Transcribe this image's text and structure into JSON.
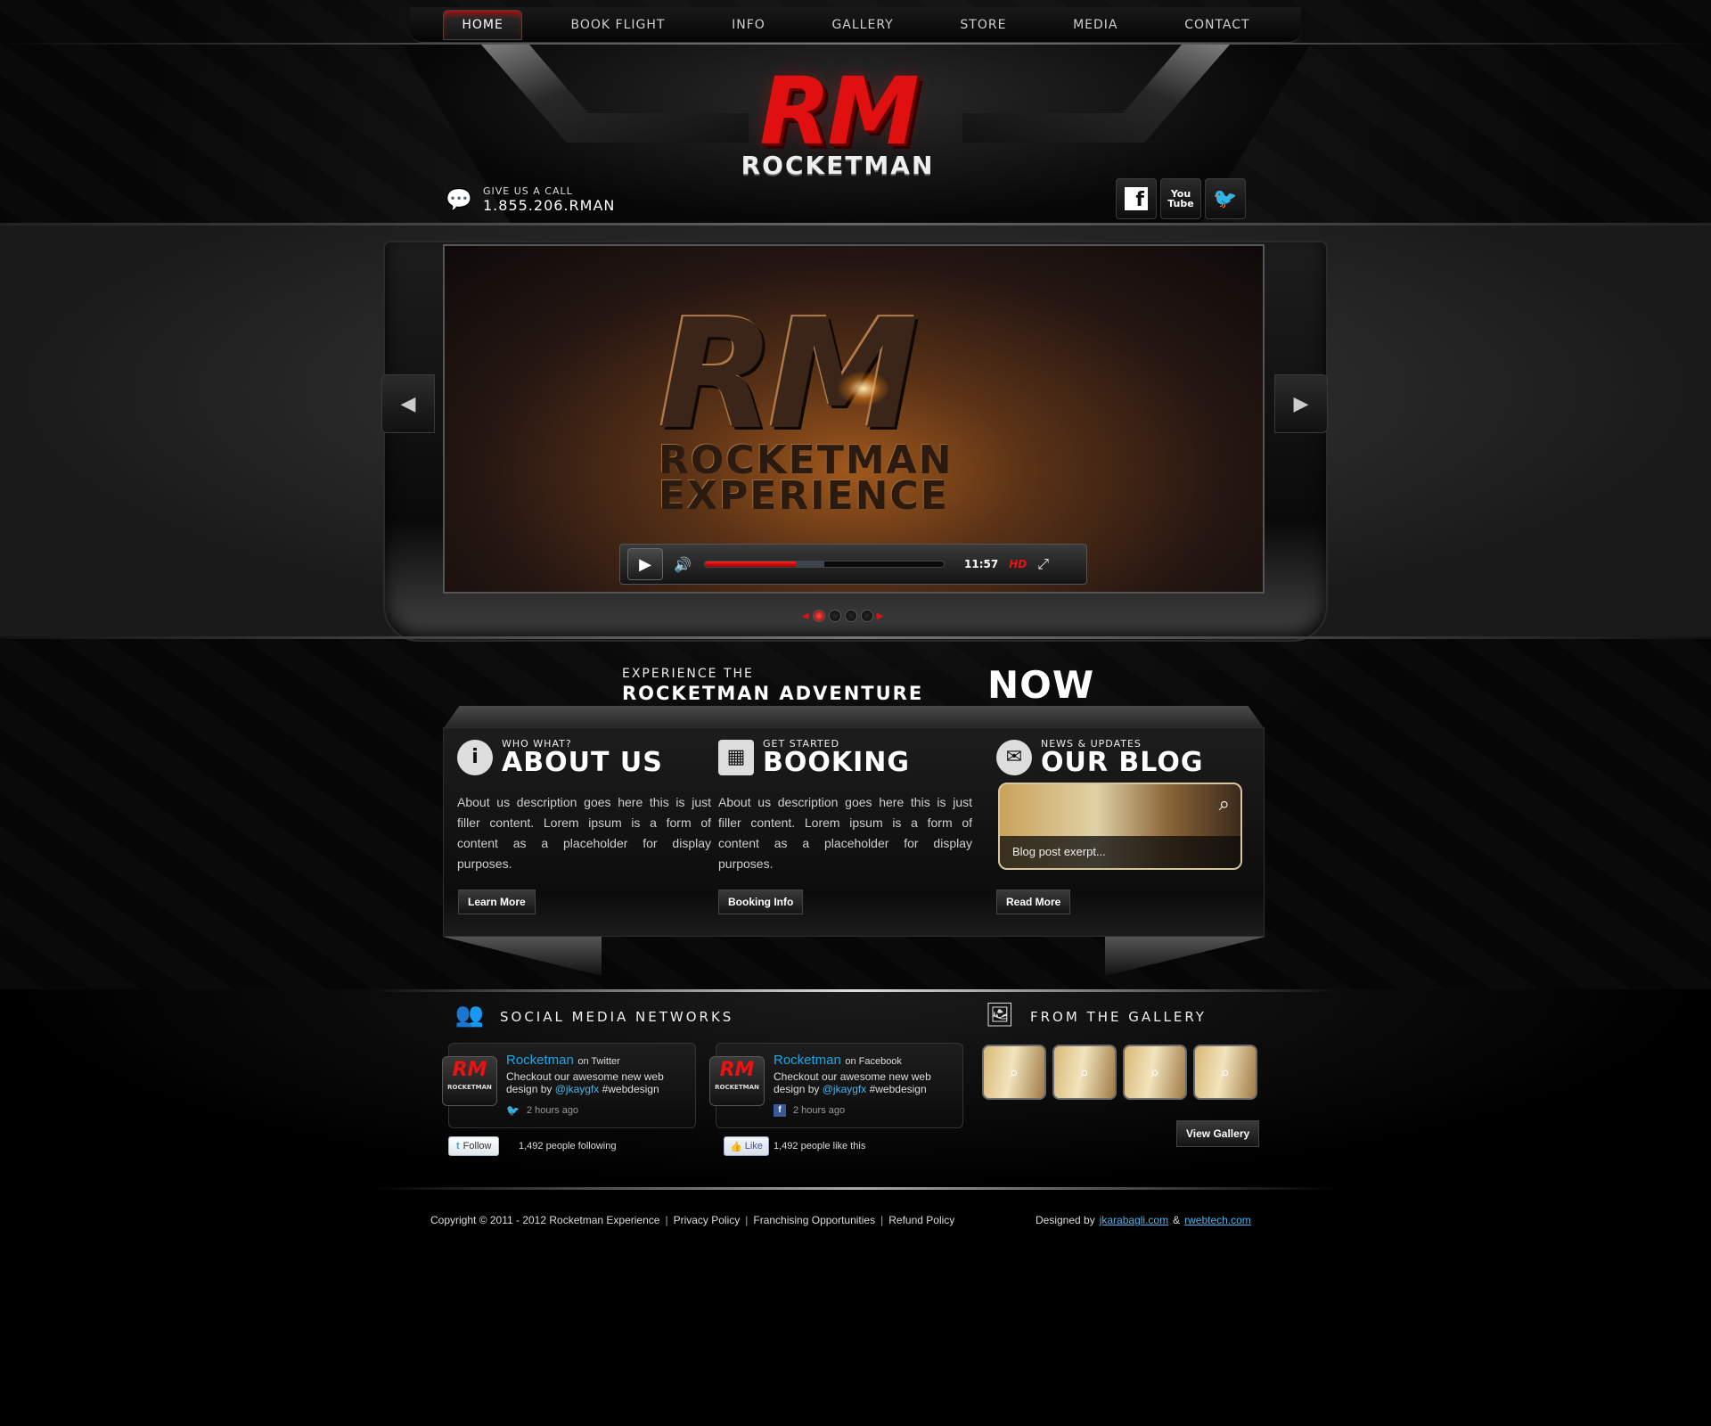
{
  "nav": {
    "items": [
      "HOME",
      "BOOK FLIGHT",
      "INFO",
      "GALLERY",
      "STORE",
      "MEDIA",
      "CONTACT"
    ],
    "active_index": 0
  },
  "header": {
    "logo_mark": "RM",
    "logo_word": "ROCKETMAN",
    "call_label": "GIVE US A CALL",
    "call_number": "1.855.206.RMAN"
  },
  "socials": {
    "facebook": "f",
    "youtube_top": "You",
    "youtube_bottom": "Tube",
    "twitter_icon": "twitter-bird-icon"
  },
  "slider": {
    "video_mark": "RM",
    "video_line1": "ROCKETMAN",
    "video_line2": "EXPERIENCE",
    "time": "11:57",
    "hd_label": "HD",
    "progress_fraction": 0.38,
    "buffer_fraction": 0.5,
    "slide_count": 4,
    "active_slide": 0
  },
  "headline": {
    "small": "EXPERIENCE THE",
    "big": "ROCKETMAN ADVENTURE",
    "now": "NOW"
  },
  "columns": {
    "about": {
      "kicker": "WHO WHAT?",
      "title": "ABOUT US",
      "body": "About us description goes here this is just filler content. Lorem ipsum is a form of content as a placeholder for display purposes.",
      "button": "Learn More"
    },
    "booking": {
      "kicker": "GET STARTED",
      "title": "BOOKING",
      "body": "About us description goes here this is just filler content. Lorem ipsum is a form of content as a placeholder for display purposes.",
      "button": "Booking Info"
    },
    "blog": {
      "kicker": "NEWS & UPDATES",
      "title": "OUR BLOG",
      "excerpt": "Blog post exerpt...",
      "button": "Read More"
    }
  },
  "social_section": {
    "title": "SOCIAL MEDIA NETWORKS",
    "twitter": {
      "name": "Rocketman",
      "on": "on Twitter",
      "text_before": "Checkout our awesome new web design by",
      "mention": "@jkaygfx",
      "text_after": "#webdesign",
      "time": "2 hours ago",
      "button": "Follow",
      "count": "1,492 people following"
    },
    "facebook": {
      "name": "Rocketman",
      "on": "on Facebook",
      "text_before": "Checkout our awesome new web design by",
      "mention": "@jkaygfx",
      "text_after": "#webdesign",
      "time": "2 hours ago",
      "button": "Like",
      "count": "1,492 people like this"
    },
    "avatar_mark": "RM",
    "avatar_word": "ROCKETMAN"
  },
  "gallery_section": {
    "title": "FROM THE GALLERY",
    "thumb_count": 4,
    "button": "View Gallery"
  },
  "footer": {
    "copyright": "Copyright © 2011 - 2012 Rocketman Experience",
    "privacy": "Privacy Policy",
    "franchising": "Franchising Opportunities",
    "refund": "Refund Policy",
    "designed_by": "Designed by",
    "credit1": "jkarabagli.com",
    "amp": "&",
    "credit2": "rwebtech.com"
  },
  "colors": {
    "accent_red": "#e01010",
    "link_blue": "#1fa6e6"
  }
}
